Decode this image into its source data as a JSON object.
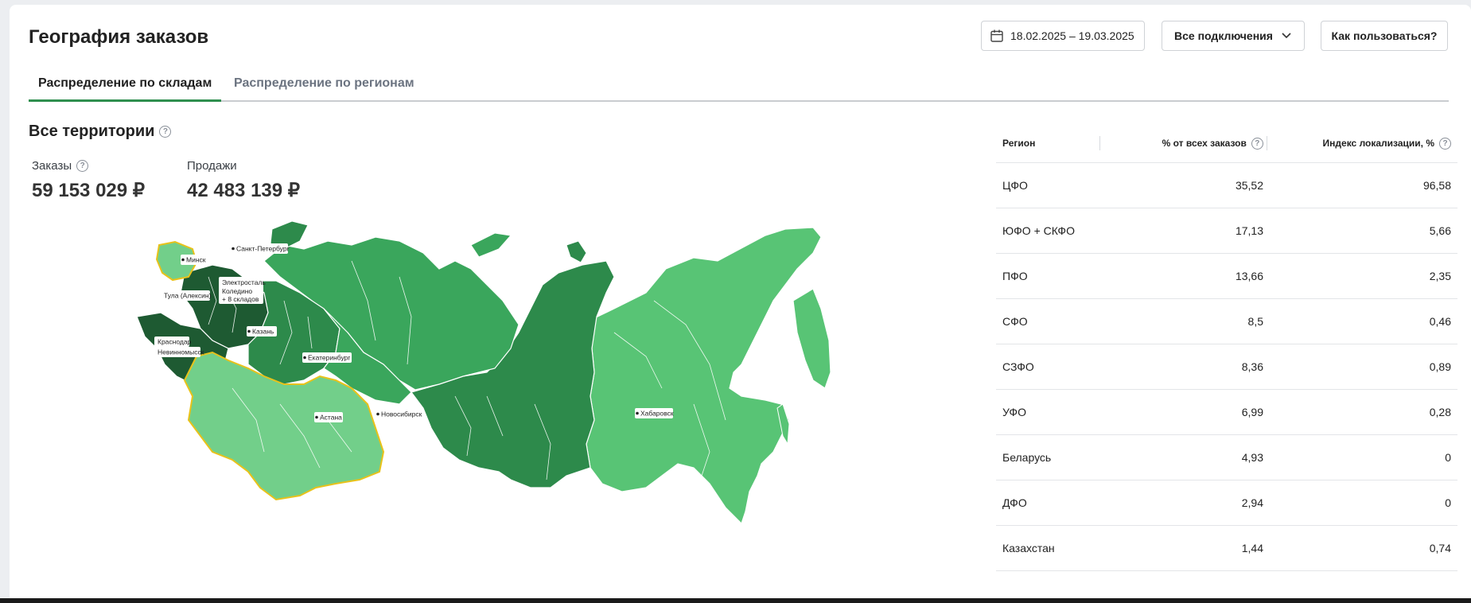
{
  "header": {
    "title": "География заказов",
    "date_range": "18.02.2025 – 19.03.2025",
    "connections_label": "Все подключения",
    "help_label": "Как пользоваться?"
  },
  "tabs": [
    {
      "label": "Распределение по складам",
      "active": true
    },
    {
      "label": "Распределение по регионам",
      "active": false
    }
  ],
  "summary": {
    "title": "Все территории",
    "orders_label": "Заказы",
    "orders_value": "59 153 029 ₽",
    "sales_label": "Продажи",
    "sales_value": "42 483 139 ₽"
  },
  "map": {
    "colors": {
      "darkest": "#1e5a32",
      "dark": "#2d8a4b",
      "medium": "#3aa65c",
      "light": "#58c475",
      "lighter": "#72cf8a",
      "border": "#e8c21a"
    },
    "labels": {
      "minsk": "Минск",
      "spb": "Санкт-Петербург",
      "elektrostal": "Электросталь",
      "koledino": "Коледино",
      "more": "+ 8 складов",
      "tula": "Тула (Алексин)",
      "kazan": "Казань",
      "krasnodar": "Краснодар",
      "nevinnomyssk": "Невинномысск",
      "ekb": "Екатеринбург",
      "novosibirsk": "Новосибирск",
      "astana": "Астана",
      "khabarovsk": "Хабаровск"
    }
  },
  "table": {
    "headers": {
      "region": "Регион",
      "share": "% от всех заказов",
      "index": "Индекс локализации, %"
    },
    "rows": [
      {
        "region": "ЦФО",
        "share": "35,52",
        "index": "96,58"
      },
      {
        "region": "ЮФО + СКФО",
        "share": "17,13",
        "index": "5,66"
      },
      {
        "region": "ПФО",
        "share": "13,66",
        "index": "2,35"
      },
      {
        "region": "СФО",
        "share": "8,5",
        "index": "0,46"
      },
      {
        "region": "СЗФО",
        "share": "8,36",
        "index": "0,89"
      },
      {
        "region": "УФО",
        "share": "6,99",
        "index": "0,28"
      },
      {
        "region": "Беларусь",
        "share": "4,93",
        "index": "0"
      },
      {
        "region": "ДФО",
        "share": "2,94",
        "index": "0"
      },
      {
        "region": "Казахстан",
        "share": "1,44",
        "index": "0,74"
      }
    ]
  }
}
